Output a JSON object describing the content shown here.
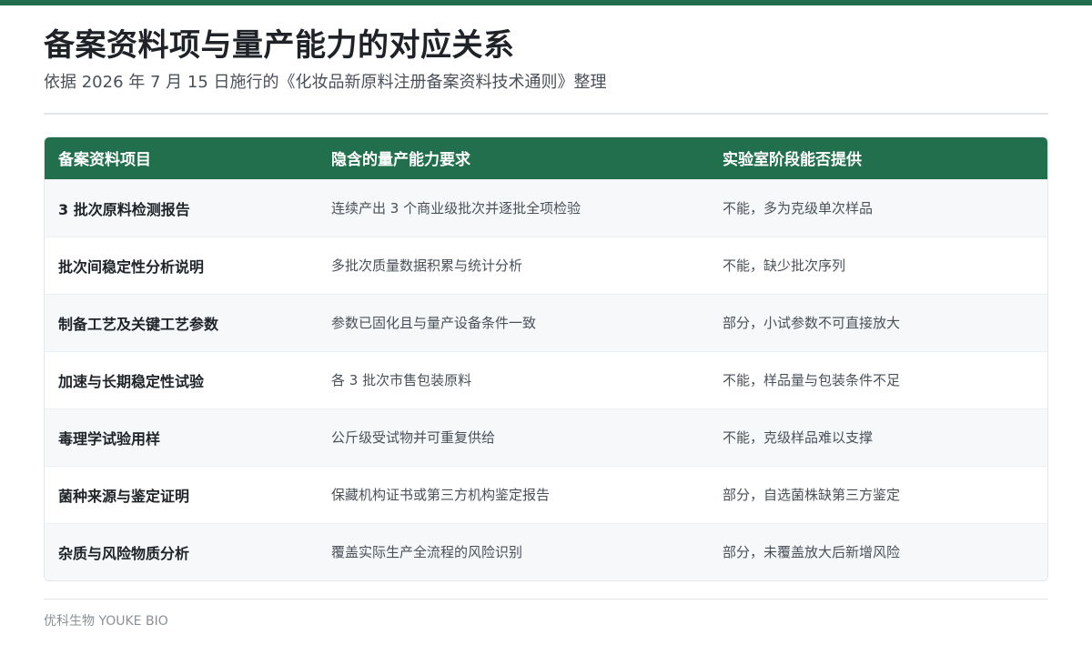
{
  "header": {
    "title": "备案资料项与量产能力的对应关系",
    "subtitle": "依据 2026 年 7 月 15 日施行的《化妆品新原料注册备案资料技术通则》整理"
  },
  "colors": {
    "brand_green": "#226f4e",
    "row_alt": "#f6f8fa"
  },
  "table": {
    "headers": [
      "备案资料项目",
      "隐含的量产能力要求",
      "实验室阶段能否提供"
    ],
    "rows": [
      [
        "3 批次原料检测报告",
        "连续产出 3 个商业级批次并逐批全项检验",
        "不能，多为克级单次样品"
      ],
      [
        "批次间稳定性分析说明",
        "多批次质量数据积累与统计分析",
        "不能，缺少批次序列"
      ],
      [
        "制备工艺及关键工艺参数",
        "参数已固化且与量产设备条件一致",
        "部分，小试参数不可直接放大"
      ],
      [
        "加速与长期稳定性试验",
        "各 3 批次市售包装原料",
        "不能，样品量与包装条件不足"
      ],
      [
        "毒理学试验用样",
        "公斤级受试物并可重复供给",
        "不能，克级样品难以支撑"
      ],
      [
        "菌种来源与鉴定证明",
        "保藏机构证书或第三方机构鉴定报告",
        "部分，自选菌株缺第三方鉴定"
      ],
      [
        "杂质与风险物质分析",
        "覆盖实际生产全流程的风险识别",
        "部分，未覆盖放大后新增风险"
      ]
    ]
  },
  "footer": {
    "brand": "优科生物 YOUKE BIO"
  }
}
